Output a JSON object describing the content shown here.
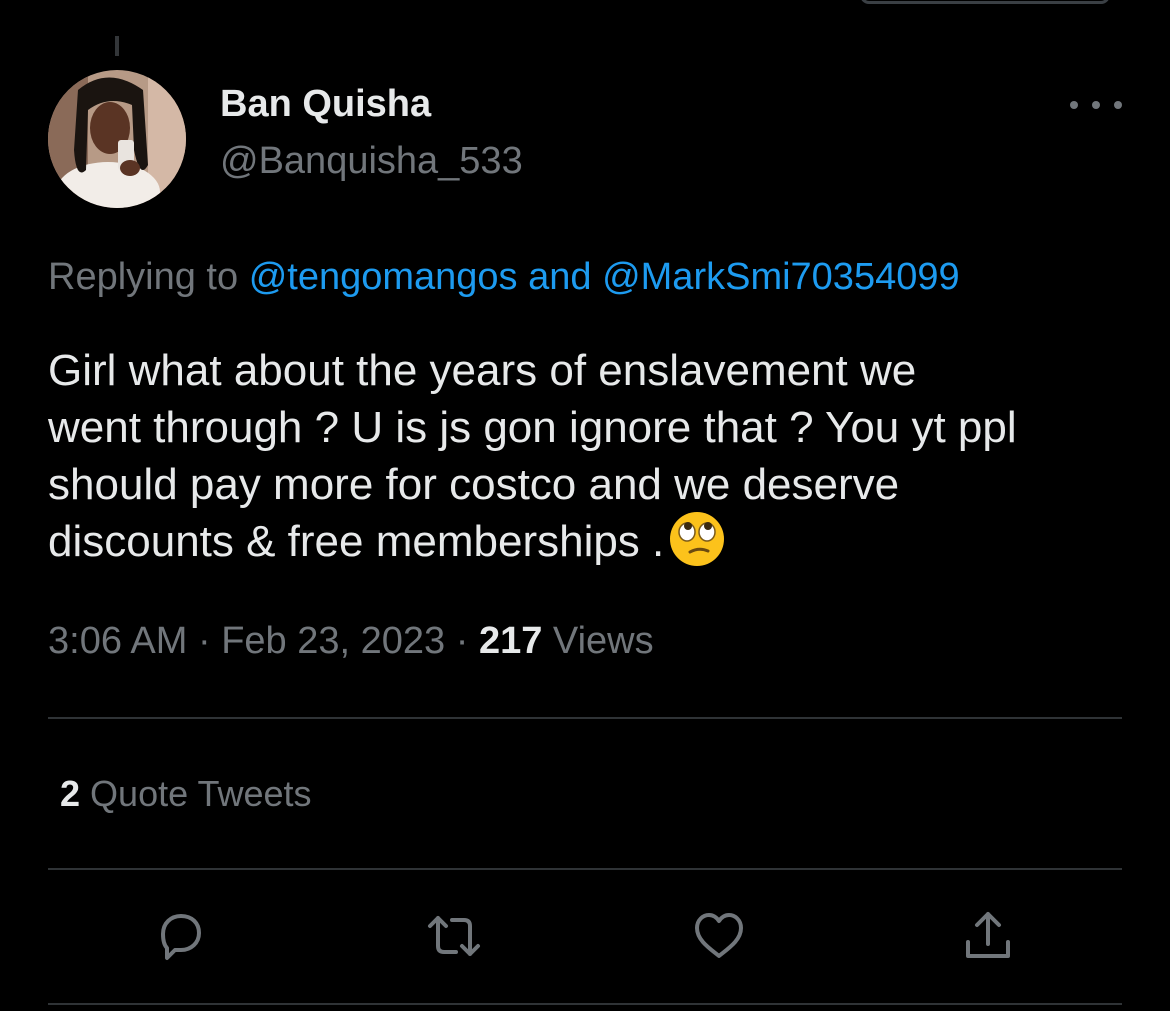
{
  "tweet": {
    "author": {
      "display_name": "Ban Quisha",
      "handle": "@Banquisha_533",
      "avatar_icon": "profile-photo"
    },
    "replying_prefix": "Replying to",
    "replying_mention_1": "@tengomangos",
    "replying_and": "and",
    "replying_mention_2": "@MarkSmi70354099",
    "text_lines": [
      "Girl what about the years of enslavement we",
      "went through ? U is js gon ignore that ? You yt ppl",
      "should pay more for costco and we deserve",
      "discounts & free memberships ."
    ],
    "emoji": "face-with-rolling-eyes",
    "time": "3:06 AM",
    "date": "Feb 23, 2023",
    "separator": "·",
    "views_count": "217",
    "views_label": "Views",
    "quote_count": "2",
    "quote_label": "Quote Tweets"
  },
  "actions": [
    {
      "name": "reply",
      "icon": "reply-icon"
    },
    {
      "name": "retweet",
      "icon": "retweet-icon"
    },
    {
      "name": "like",
      "icon": "heart-icon"
    },
    {
      "name": "share",
      "icon": "share-icon"
    }
  ],
  "colors": {
    "background": "#000000",
    "primary_text": "#e7e9ea",
    "secondary_text": "#71767b",
    "link": "#1d9bf0",
    "divider": "#2f3336"
  }
}
